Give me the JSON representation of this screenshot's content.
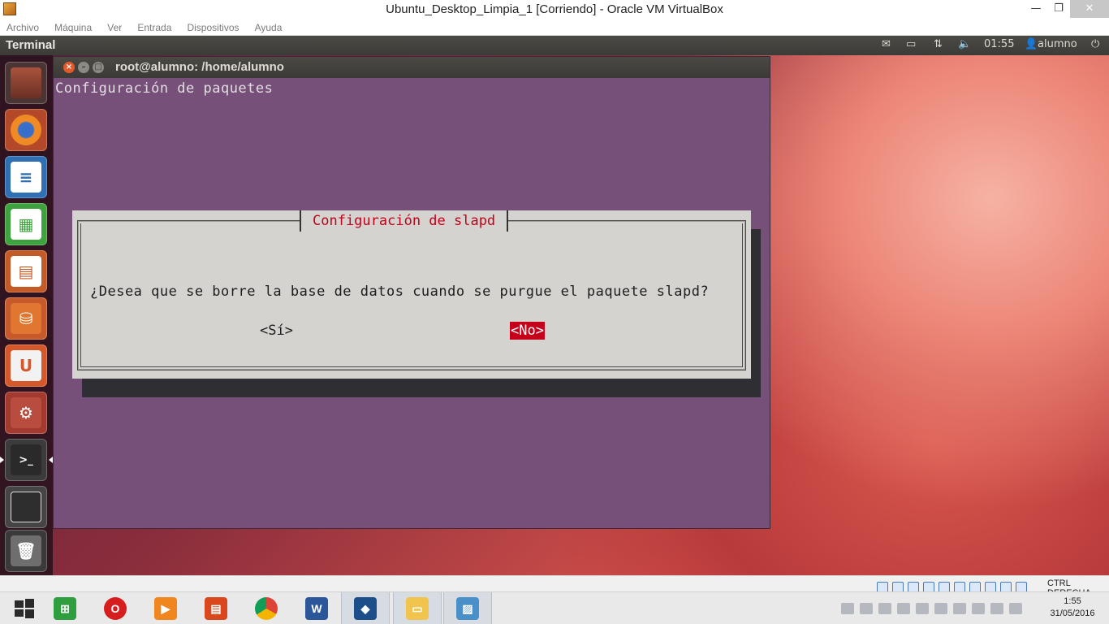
{
  "host_window": {
    "title": "Ubuntu_Desktop_Limpia_1 [Corriendo] - Oracle VM VirtualBox",
    "minimize": "—",
    "maximize": "❐",
    "close": "✕"
  },
  "vb_menu": {
    "items": [
      "Archivo",
      "Máquina",
      "Ver",
      "Entrada",
      "Dispositivos",
      "Ayuda"
    ]
  },
  "ubuntu_panel": {
    "app_name": "Terminal",
    "clock": "01:55",
    "user": "alumno"
  },
  "launcher": {
    "items": [
      "dash-home",
      "firefox",
      "libreoffice-writer",
      "libreoffice-calc",
      "libreoffice-impress",
      "ubuntu-software-center",
      "ubuntu-one",
      "system-settings",
      "terminal",
      "workspace-switcher",
      "trash"
    ]
  },
  "terminal": {
    "title": "root@alumno: /home/alumno",
    "header": "Configuración de paquetes",
    "dialog": {
      "title": "Configuración de slapd",
      "question": "¿Desea que se borre la base de datos cuando se purgue el paquete slapd?",
      "yes_label": "<Sí>",
      "no_label": "<No>",
      "selected": "no"
    }
  },
  "vb_status": {
    "host_key": "CTRL DERECHA"
  },
  "taskbar": {
    "clock_time": "1:55",
    "clock_date": "31/05/2016"
  },
  "colors": {
    "terminal_bg": "#77507a",
    "dialog_bg": "#d4d3d0",
    "dialog_accent": "#c4001a",
    "ubuntu_panel": "#3c3b37"
  }
}
